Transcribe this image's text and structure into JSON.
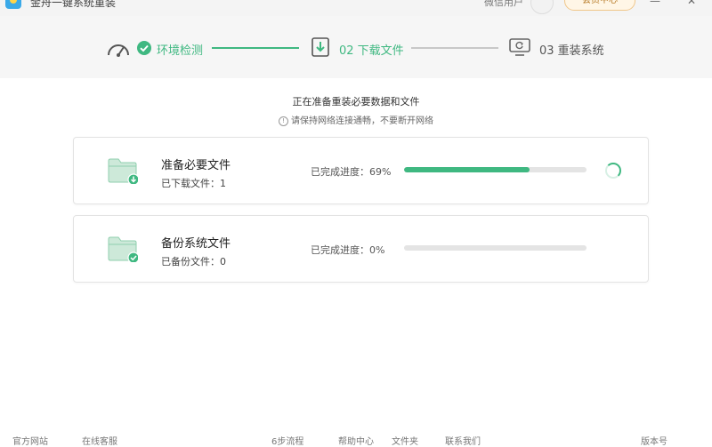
{
  "window": {
    "title": "金舟一键系统重装",
    "user_name": "微信用户",
    "member_button": "会员中心",
    "minimize": "—",
    "close": "✕"
  },
  "steps": [
    {
      "label": "环境检测",
      "state": "done",
      "icon": "gauge-icon"
    },
    {
      "label": "02 下载文件",
      "state": "active",
      "icon": "download-file-icon"
    },
    {
      "label": "03 重装系统",
      "state": "pending",
      "icon": "reinstall-monitor-icon"
    }
  ],
  "main": {
    "title": "正在准备重装必要数据和文件",
    "tip": "请保持网络连接通畅，不要断开网络",
    "tip_icon": "!"
  },
  "tasks": [
    {
      "title": "准备必要文件",
      "sub": "已下载文件：1",
      "progress_label": "已完成进度：69%",
      "progress": 69,
      "status": "loading",
      "badge_icon": "download-badge-icon"
    },
    {
      "title": "备份系统文件",
      "sub": "已备份文件：0",
      "progress_label": "已完成进度：0%",
      "progress": 0,
      "status": "idle",
      "badge_icon": "check-badge-icon"
    }
  ],
  "statusbar": {
    "items": [
      "官方网站",
      "在线客服",
      "6步流程",
      "帮助中心",
      "文件夹",
      "联系我们"
    ],
    "version": "版本号"
  },
  "colors": {
    "accent": "#3fb881",
    "track": "#e4e4e4",
    "folder": "#cde9d9"
  }
}
